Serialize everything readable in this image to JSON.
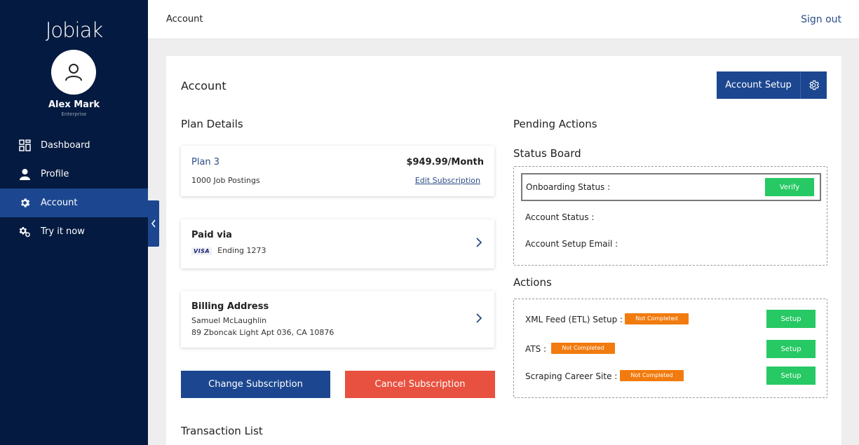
{
  "sidebar": {
    "logo": "Jobiak",
    "user_name": "Alex Mark",
    "user_plan": "Enterprise",
    "nav": [
      {
        "label": "Dashboard",
        "icon": "dashboard-grid-icon",
        "active": false
      },
      {
        "label": "Profile",
        "icon": "person-icon",
        "active": false
      },
      {
        "label": "Account",
        "icon": "gear-icon",
        "active": true
      },
      {
        "label": "Try it now",
        "icon": "gears-icon",
        "active": false
      }
    ]
  },
  "topbar": {
    "breadcrumb": "Account",
    "sign_out": "Sign out"
  },
  "account": {
    "title": "Account",
    "setup_button": "Account Setup"
  },
  "plan": {
    "section_title": "Plan Details",
    "name": "Plan 3",
    "price": "$949.99/Month",
    "postings": "1000 Job Postings",
    "edit_link": "Edit Subscription"
  },
  "payment": {
    "label": "Paid via",
    "card_brand": "VISA",
    "ending": "Ending 1273"
  },
  "billing": {
    "label": "Billing Address",
    "name": "Samuel McLaughlin",
    "address": "89 Zboncak Light Apt 036, CA 10876"
  },
  "buttons": {
    "change": "Change Subscription",
    "cancel": "Cancel Subscription"
  },
  "transactions": {
    "title": "Transaction List"
  },
  "pending": {
    "title": "Pending Actions",
    "status_board_title": "Status Board",
    "onboarding_label": "Onboarding Status :",
    "verify_button": "Verify",
    "account_status_label": "Account Status :",
    "setup_email_label": "Account Setup Email :"
  },
  "actions": {
    "title": "Actions",
    "items": [
      {
        "label": "XML Feed (ETL) Setup :",
        "status": "Not Completed",
        "button": "Setup"
      },
      {
        "label": "ATS :",
        "status": "Not Completed",
        "button": "Setup"
      },
      {
        "label": "Scraping Career Site :",
        "status": "Not Completed",
        "button": "Setup"
      }
    ]
  },
  "colors": {
    "sidebar_bg": "#041a40",
    "primary_blue": "#1c4790",
    "cancel_red": "#e8513f",
    "success_green": "#27c964",
    "badge_orange": "#f27b0f"
  }
}
